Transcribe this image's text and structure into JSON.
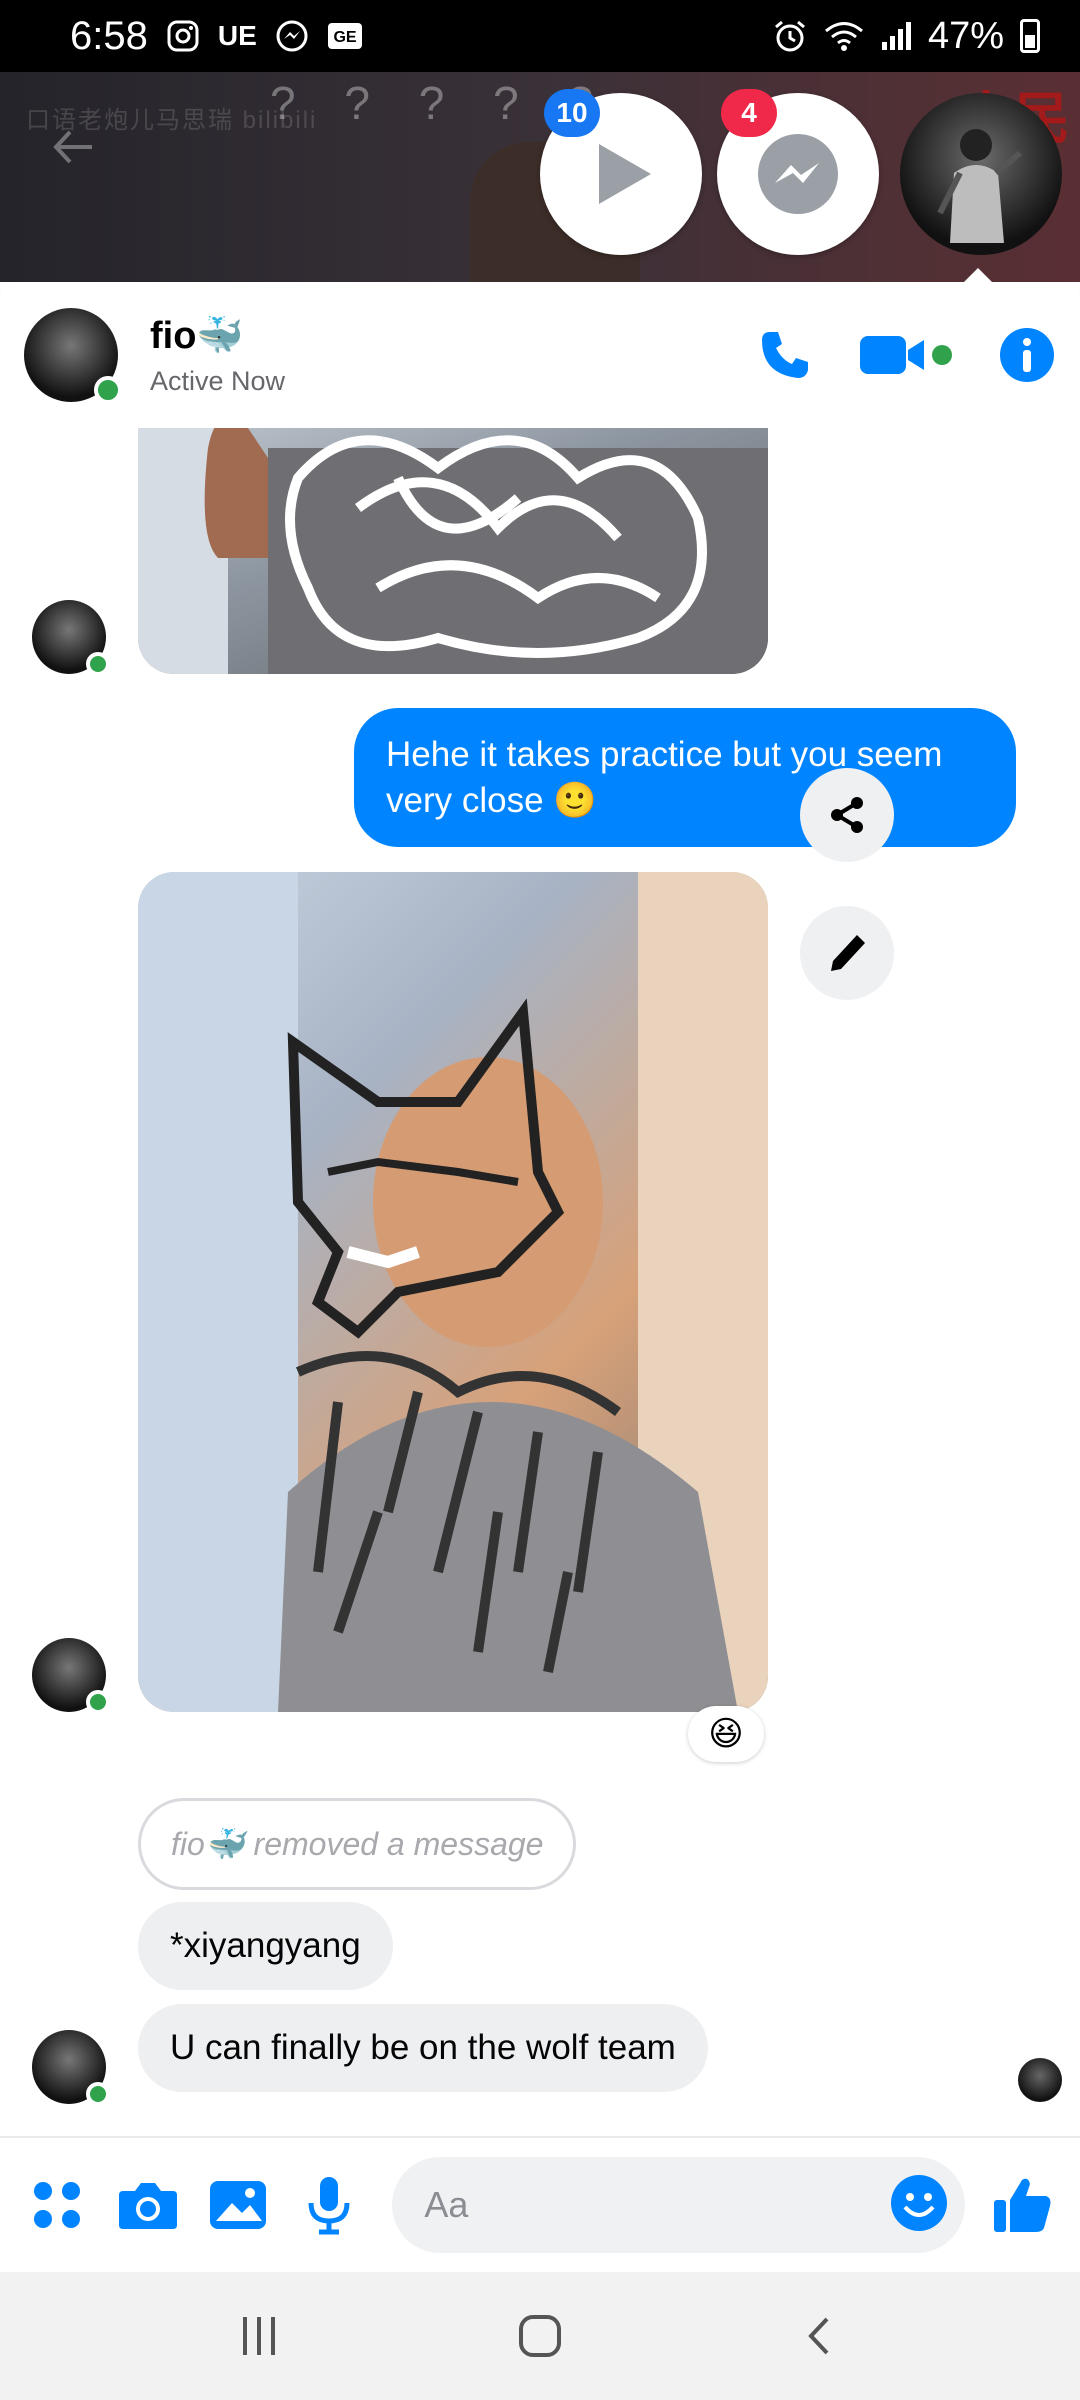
{
  "status_bar": {
    "time": "6:58",
    "left_icons": [
      "instagram-icon",
      "ue-icon",
      "messenger-icon",
      "ge-icon"
    ],
    "battery": "47%",
    "right_icons": [
      "alarm-icon",
      "wifi-icon",
      "signal-icon",
      "battery-icon"
    ]
  },
  "background": {
    "qmarks": "? ? ? ? ?",
    "faint_text": "口语老炮儿马思瑞 bilibili",
    "red_text": "人民"
  },
  "chat_heads": [
    {
      "name": "video-player",
      "badge": "10",
      "badge_color": "#1877f2"
    },
    {
      "name": "messenger",
      "badge": "4",
      "badge_color": "#f02849"
    }
  ],
  "header": {
    "name": "fio🐳",
    "status": "Active Now"
  },
  "messages": {
    "sent_1": "Hehe it takes practice but you seem very close 🙂",
    "reaction": "😆",
    "removed": "fio🐳 removed a message",
    "recv_1": "*xiyangyang",
    "recv_2": "U can finally be on the wolf team"
  },
  "composer": {
    "placeholder": "Aa"
  },
  "colors": {
    "accent": "#0084ff",
    "online": "#31a24c",
    "badge_blue": "#1877f2",
    "badge_red": "#f02849"
  }
}
